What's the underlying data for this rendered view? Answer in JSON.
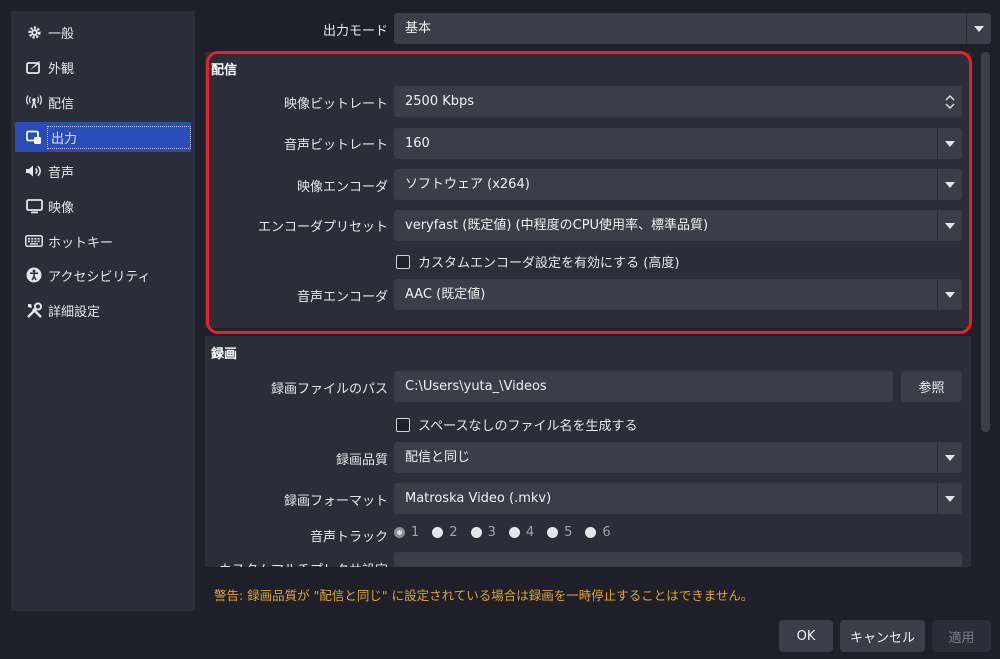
{
  "sidebar": {
    "items": [
      {
        "label": "一般",
        "icon": "gear-icon"
      },
      {
        "label": "外観",
        "icon": "appearance-icon"
      },
      {
        "label": "配信",
        "icon": "broadcast-icon"
      },
      {
        "label": "出力",
        "icon": "output-icon",
        "active": true
      },
      {
        "label": "音声",
        "icon": "speaker-icon"
      },
      {
        "label": "映像",
        "icon": "monitor-icon"
      },
      {
        "label": "ホットキー",
        "icon": "keyboard-icon"
      },
      {
        "label": "アクセシビリティ",
        "icon": "accessibility-icon"
      },
      {
        "label": "詳細設定",
        "icon": "tools-icon"
      }
    ]
  },
  "output_mode": {
    "label": "出力モード",
    "value": "基本"
  },
  "streaming": {
    "title": "配信",
    "video_bitrate": {
      "label": "映像ビットレート",
      "value": "2500 Kbps"
    },
    "audio_bitrate": {
      "label": "音声ビットレート",
      "value": "160"
    },
    "video_encoder": {
      "label": "映像エンコーダ",
      "value": "ソフトウェア (x264)"
    },
    "encoder_preset": {
      "label": "エンコーダプリセット",
      "value": "veryfast (既定値) (中程度のCPU使用率、標準品質)"
    },
    "custom_encoder_checkbox": "カスタムエンコーダ設定を有効にする (高度)",
    "audio_encoder": {
      "label": "音声エンコーダ",
      "value": "AAC (既定値)"
    }
  },
  "recording": {
    "title": "録画",
    "path": {
      "label": "録画ファイルのパス",
      "value": "C:\\Users\\yuta_\\Videos",
      "browse": "参照"
    },
    "no_space_checkbox": "スペースなしのファイル名を生成する",
    "quality": {
      "label": "録画品質",
      "value": "配信と同じ"
    },
    "format": {
      "label": "録画フォーマット",
      "value": "Matroska Video (.mkv)"
    },
    "audio_track": {
      "label": "音声トラック",
      "tracks": [
        "1",
        "2",
        "3",
        "4",
        "5",
        "6"
      ],
      "selected": "1"
    },
    "custom_muxer": {
      "label": "カスタムマルチプレクサ設定"
    }
  },
  "warning": "警告: 録画品質が \"配信と同じ\" に設定されている場合は録画を一時停止することはできません。",
  "buttons": {
    "ok": "OK",
    "cancel": "キャンセル",
    "apply": "適用"
  },
  "colors": {
    "highlight": "#e8202c",
    "accent": "#284cb8",
    "warning": "#e3a52a"
  }
}
